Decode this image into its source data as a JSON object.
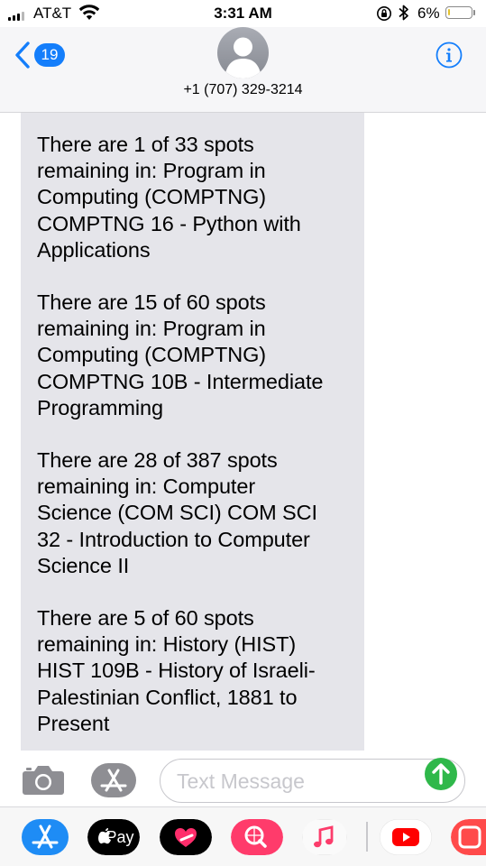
{
  "status_bar": {
    "carrier": "AT&T",
    "time": "3:31 AM",
    "battery_percent": "6%",
    "battery_level": 0.06,
    "battery_color": "#e3c22e",
    "icons": [
      "signal-icon",
      "wifi-icon",
      "rotation-lock-icon",
      "bluetooth-icon",
      "battery-icon"
    ]
  },
  "header": {
    "back_count": "19",
    "contact": "+1 (707) 329-3214",
    "accent_color": "#147efb",
    "icons": [
      "back-chevron-icon",
      "avatar-icon",
      "info-icon"
    ]
  },
  "messages": [
    {
      "text": "There are 1 of 33 spots\nremaining in:  Program in\nComputing (COMPTNG)\nCOMPTNG 16 - Python with\nApplications"
    },
    {
      "text": "There are 15 of 60 spots\nremaining in:  Program in\nComputing (COMPTNG)\nCOMPTNG 10B - Intermediate\nProgramming"
    },
    {
      "text": "There are 28 of 387 spots\nremaining in:  Computer\nScience (COM SCI) COM SCI\n32 - Introduction to Computer\nScience II"
    },
    {
      "text": "There are 5 of 60 spots\nremaining in:  History (HIST)\nHIST 109B - History of Israeli-\nPalestinian Conflict, 1881 to\nPresent"
    }
  ],
  "bubble_color": "#e5e5ea",
  "input_bar": {
    "placeholder": "Text Message",
    "send_color": "#2fb84a",
    "icons": [
      "camera-icon",
      "app-store-icon",
      "send-arrow-icon"
    ]
  },
  "app_drawer": {
    "apple_pay_label": "Pay",
    "apps": [
      "app-store-app-icon",
      "apple-pay-app-icon",
      "digital-touch-app-icon",
      "images-search-app-icon",
      "music-app-icon",
      "youtube-app-icon",
      "partial-app-icon"
    ]
  }
}
